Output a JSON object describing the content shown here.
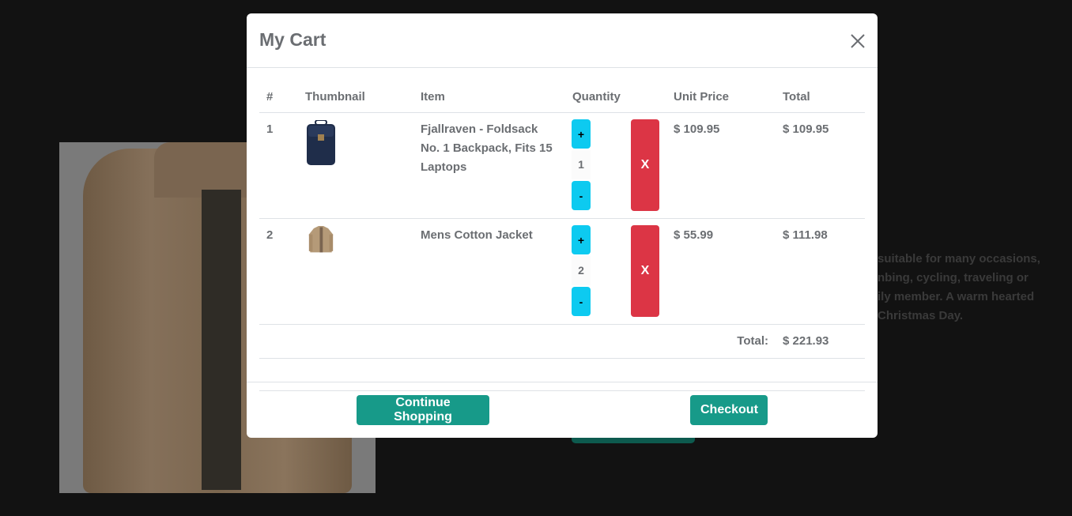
{
  "background": {
    "description_lines": [
      "suitable for many occasions,",
      "nbing, cycling, traveling or",
      "ily member. A warm hearted",
      "Christmas Day."
    ]
  },
  "modal": {
    "title": "My Cart",
    "close_icon": "close-icon",
    "table": {
      "headers": [
        "#",
        "Thumbnail",
        "Item",
        "Quantity",
        "Unit Price",
        "Total"
      ],
      "rows": [
        {
          "index": "1",
          "thumbnail": "backpack-thumbnail",
          "item": "Fjallraven - Foldsack No. 1 Backpack, Fits 15 Laptops",
          "plus": "+",
          "quantity": "1",
          "minus": "-",
          "remove": "X",
          "unit_price": "$ 109.95",
          "total": "$ 109.95"
        },
        {
          "index": "2",
          "thumbnail": "jacket-thumbnail",
          "item": "Mens Cotton Jacket",
          "plus": "+",
          "quantity": "2",
          "minus": "-",
          "remove": "X",
          "unit_price": "$ 55.99",
          "total": "$ 111.98"
        }
      ],
      "total_label": "Total:",
      "total_value": "$ 221.93"
    },
    "footer": {
      "continue_label": "Continue Shopping",
      "checkout_label": "Checkout"
    }
  },
  "colors": {
    "accent": "#179a89",
    "info": "#0dcaf0",
    "danger": "#dc3545"
  }
}
